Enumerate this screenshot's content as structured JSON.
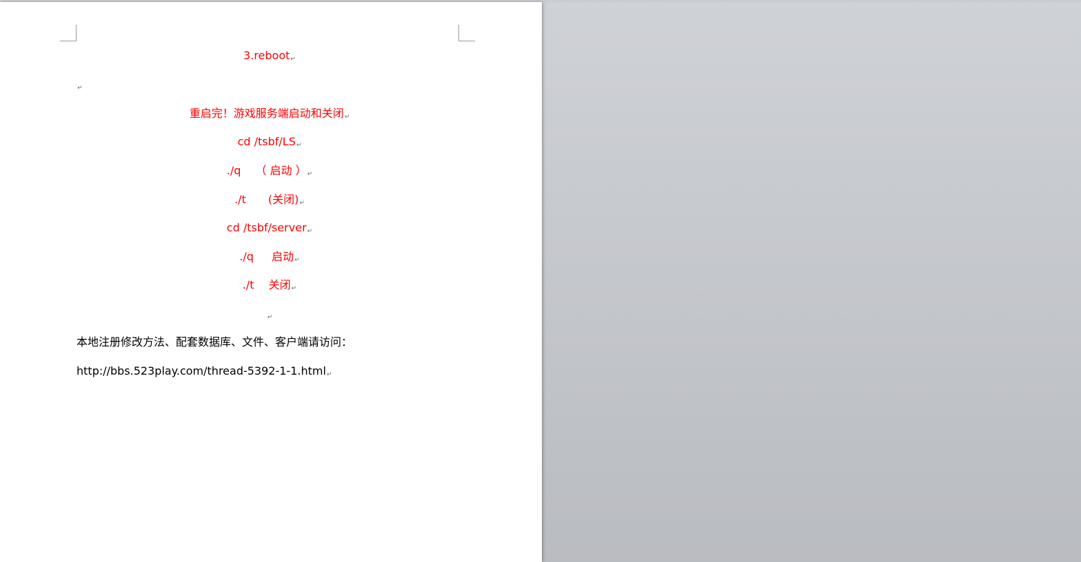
{
  "document": {
    "paragraphs": [
      {
        "text": "3.reboot",
        "color": "#ff0000",
        "align": "center"
      },
      {
        "text": "",
        "color": "#000000",
        "align": "left"
      },
      {
        "text": "重启完！游戏服务端启动和关闭",
        "color": "#ff0000",
        "align": "center"
      },
      {
        "text": "cd /tsbf/LS",
        "color": "#ff0000",
        "align": "center"
      },
      {
        "text": "./q　 （ 启动 ）",
        "color": "#ff0000",
        "align": "center"
      },
      {
        "text": "./t　　(关闭)",
        "color": "#ff0000",
        "align": "center"
      },
      {
        "text": "cd /tsbf/server",
        "color": "#ff0000",
        "align": "center"
      },
      {
        "text": "./q　  启动",
        "color": "#ff0000",
        "align": "center"
      },
      {
        "text": "./t　 关闭",
        "color": "#ff0000",
        "align": "center"
      },
      {
        "text": "",
        "color": "#000000",
        "align": "center"
      },
      {
        "text": "本地注册修改方法、配套数据库、文件、客户端请访问：",
        "color": "#000000",
        "align": "left"
      },
      {
        "text": "http://bbs.523play.com/thread-5392-1-1.html",
        "color": "#000000",
        "align": "left"
      }
    ],
    "paragraph_mark": "↵"
  },
  "colors": {
    "accent_red": "#ff0000",
    "text_black": "#000000",
    "page_background": "#ffffff",
    "workspace_background": "#c4c7cc"
  }
}
